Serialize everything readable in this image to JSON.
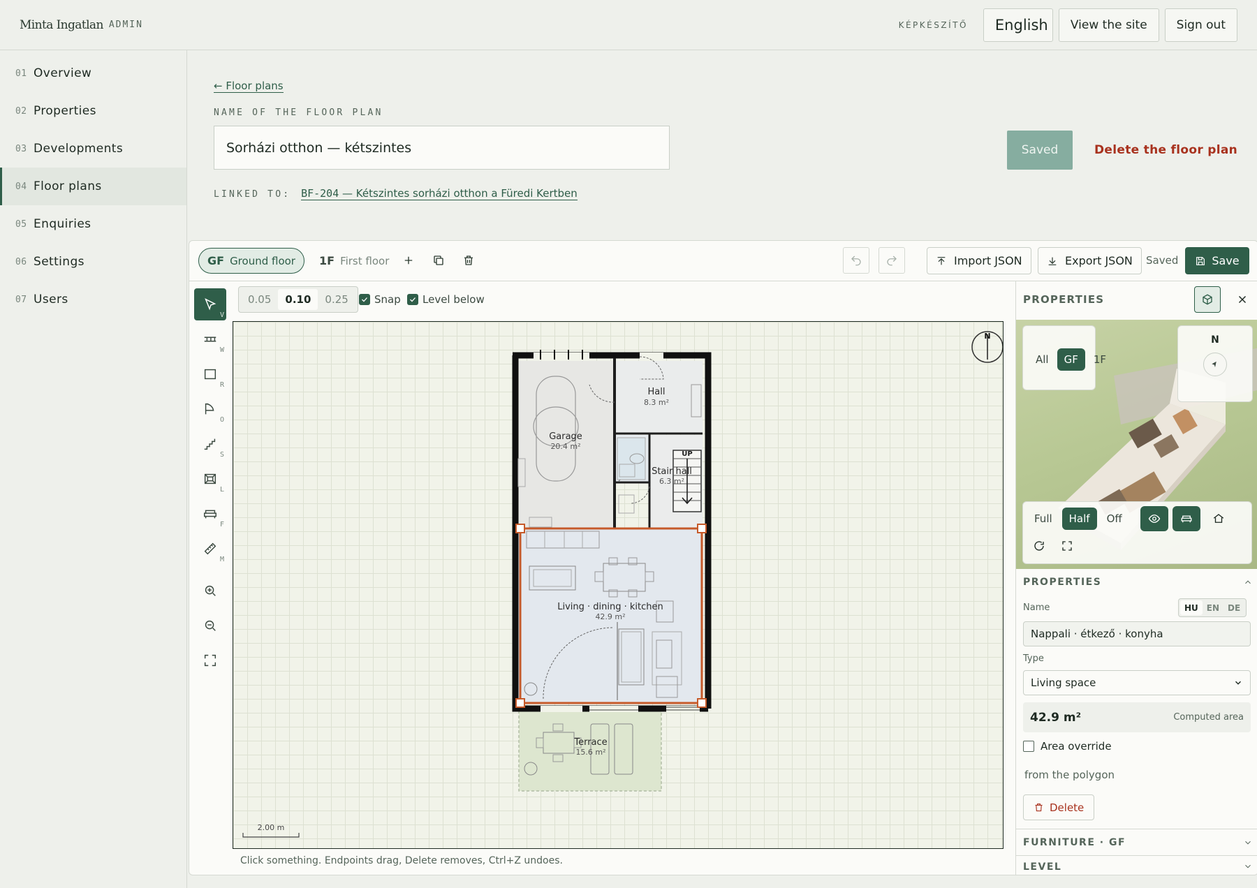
{
  "brand": {
    "name": "Minta Ingatlan",
    "sub": "ADMIN"
  },
  "header": {
    "maker_label": "KÉPKÉSZÍTŐ",
    "language": "English",
    "view_site": "View the site",
    "sign_out": "Sign out"
  },
  "sidebar": {
    "items": [
      {
        "num": "01",
        "label": "Overview"
      },
      {
        "num": "02",
        "label": "Properties"
      },
      {
        "num": "03",
        "label": "Developments"
      },
      {
        "num": "04",
        "label": "Floor plans",
        "active": true
      },
      {
        "num": "05",
        "label": "Enquiries"
      },
      {
        "num": "06",
        "label": "Settings"
      },
      {
        "num": "07",
        "label": "Users"
      }
    ]
  },
  "page": {
    "back_link": "← Floor plans",
    "name_label": "NAME OF THE FLOOR PLAN",
    "name_value": "Sorházi otthon — kétszintes",
    "saved_button": "Saved",
    "delete_plan": "Delete the floor plan",
    "linked_label": "LINKED TO:",
    "linked_code": "BF-204",
    "linked_text": "— Kétszintes sorházi otthon a Füredi Kertben"
  },
  "editor": {
    "floors": [
      {
        "code": "GF",
        "label": "Ground floor",
        "active": true
      },
      {
        "code": "1F",
        "label": "First floor",
        "active": false
      }
    ],
    "import_json": "Import JSON",
    "export_json": "Export JSON",
    "saved_status": "Saved",
    "save": "Save",
    "tools": [
      {
        "icon": "pointer-icon",
        "key": "V",
        "active": true
      },
      {
        "icon": "wall-icon",
        "key": "W"
      },
      {
        "icon": "room-icon",
        "key": "R"
      },
      {
        "icon": "door-icon",
        "key": "O"
      },
      {
        "icon": "stairs-icon",
        "key": "S"
      },
      {
        "icon": "window-icon",
        "key": "L"
      },
      {
        "icon": "furniture-icon",
        "key": "F"
      },
      {
        "icon": "measure-icon",
        "key": "M"
      }
    ],
    "grid_sizes": [
      "0.05",
      "0.10",
      "0.25"
    ],
    "grid_active": "0.10",
    "snap_label": "Snap",
    "level_below_label": "Level below",
    "hint": "Click something. Endpoints drag, Delete removes, Ctrl+Z undoes.",
    "scale_label": "2.00 m",
    "compass_label": "N",
    "stairs_label": "UP",
    "rooms": [
      {
        "name": "Hall",
        "area": "8.3 m²"
      },
      {
        "name": "Garage",
        "area": "20.4 m²"
      },
      {
        "name": "Stair hall",
        "area": "6.3 m²"
      },
      {
        "name": "Living · dining · kitchen",
        "area": "42.9 m²",
        "selected": true
      },
      {
        "name": "Terrace",
        "area": "15.6 m²"
      }
    ]
  },
  "properties_panel": {
    "title": "PROPERTIES",
    "preview": {
      "floor_options": [
        "All",
        "GF",
        "1F"
      ],
      "floor_active": "GF",
      "north_label": "N",
      "wall_modes": [
        "Full",
        "Half",
        "Off"
      ],
      "wall_active": "Half"
    },
    "section_title": "PROPERTIES",
    "name_label": "Name",
    "langs": [
      "HU",
      "EN",
      "DE"
    ],
    "lang_active": "HU",
    "name_value": "Nappali · étkező · konyha",
    "type_label": "Type",
    "type_value": "Living space",
    "area_value": "42.9 m²",
    "area_caption": "Computed area",
    "override_label": "Area override",
    "from_polygon": "from the polygon",
    "delete": "Delete",
    "furniture_section": "FURNITURE · GF",
    "level_section": "LEVEL"
  }
}
